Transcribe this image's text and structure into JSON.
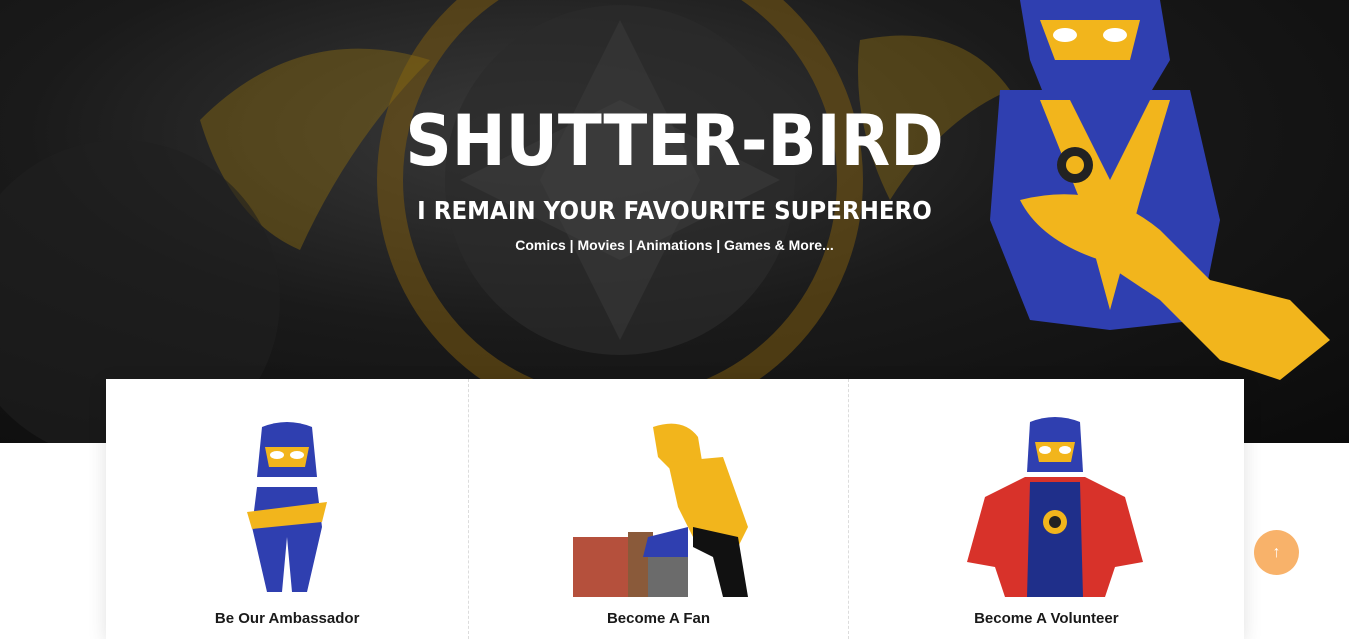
{
  "hero": {
    "title": "SHUTTER-BIRD",
    "subtitle": "I REMAIN YOUR FAVOURITE SUPERHERO",
    "tagline": "Comics | Movies | Animations | Games & More..."
  },
  "cards": [
    {
      "label": "Be Our Ambassador",
      "image": "ambassador-hero-illustration"
    },
    {
      "label": "Become A Fan",
      "image": "fan-child-illustration"
    },
    {
      "label": "Become A Volunteer",
      "image": "volunteer-hero-illustration"
    }
  ],
  "scroll_top": {
    "icon": "↑",
    "icon_name": "arrow-up-icon"
  },
  "colors": {
    "accent": "#f8b26a",
    "hero_blue": "#2f3fb0",
    "hero_gold": "#f2b51c"
  }
}
